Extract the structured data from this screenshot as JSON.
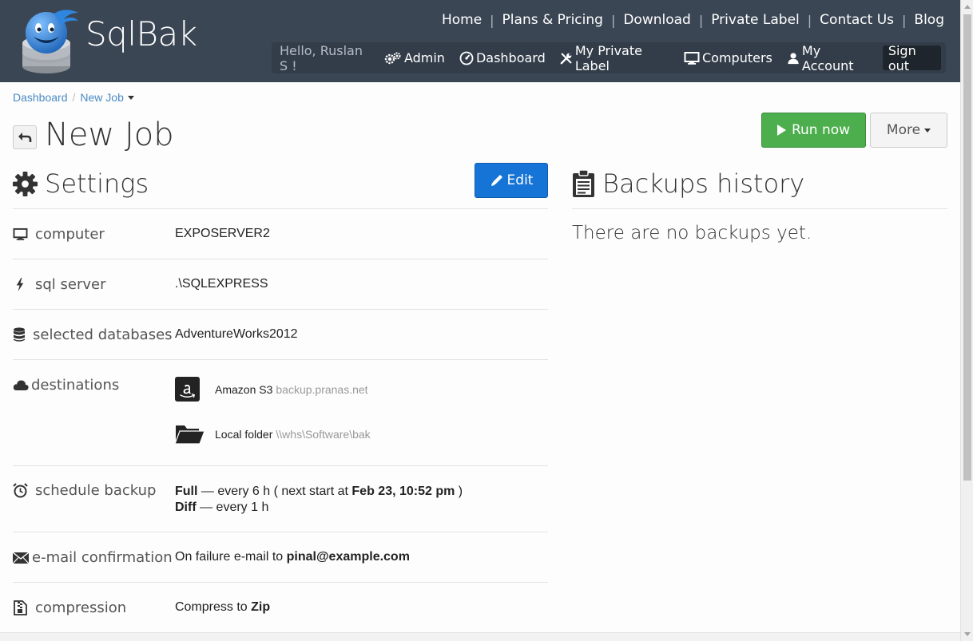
{
  "brand": {
    "name": "SqlBak"
  },
  "topnav": [
    {
      "label": "Home"
    },
    {
      "label": "Plans & Pricing"
    },
    {
      "label": "Download"
    },
    {
      "label": "Private Label"
    },
    {
      "label": "Contact Us"
    },
    {
      "label": "Blog"
    }
  ],
  "usernav": {
    "hello": "Hello, Ruslan S !",
    "admin": "Admin",
    "dashboard": "Dashboard",
    "private_label": "My Private Label",
    "computers": "Computers",
    "account": "My Account",
    "signout": "Sign out"
  },
  "breadcrumb": {
    "root": "Dashboard",
    "sep": "/",
    "current": "New Job"
  },
  "page": {
    "title": "New Job"
  },
  "actions": {
    "run": "Run now",
    "more": "More"
  },
  "settings": {
    "title": "Settings",
    "edit": "Edit",
    "computer_label": "computer",
    "computer_value": "EXPOSERVER2",
    "sqlserver_label": "sql server",
    "sqlserver_value": ".\\SQLEXPRESS",
    "databases_label": "selected databases",
    "databases_value": "AdventureWorks2012",
    "destinations_label": "destinations",
    "destinations": [
      {
        "type": "Amazon S3",
        "path": "backup.pranas.net"
      },
      {
        "type": "Local folder",
        "path": "\\\\whs\\Software\\bak"
      }
    ],
    "schedule_label": "schedule backup",
    "schedule": {
      "full_kind": "Full",
      "full_text": " — every 6 h ( next start at ",
      "full_next": "Feb 23, 10:52 pm",
      "full_end": " )",
      "diff_kind": "Diff",
      "diff_text": " — every 1 h"
    },
    "email_label": "e-mail confirmation",
    "email_text": "On failure e-mail to ",
    "email_address": "pinal@example.com",
    "compression_label": "compression",
    "compression_text": "Compress to ",
    "compression_format": "Zip"
  },
  "backups": {
    "title": "Backups history",
    "empty": "There are no backups yet."
  },
  "colors": {
    "header_bg": "#3b4654",
    "run_green": "#4cae4c",
    "edit_blue": "#1674d6",
    "link_blue": "#4a8ac4"
  }
}
